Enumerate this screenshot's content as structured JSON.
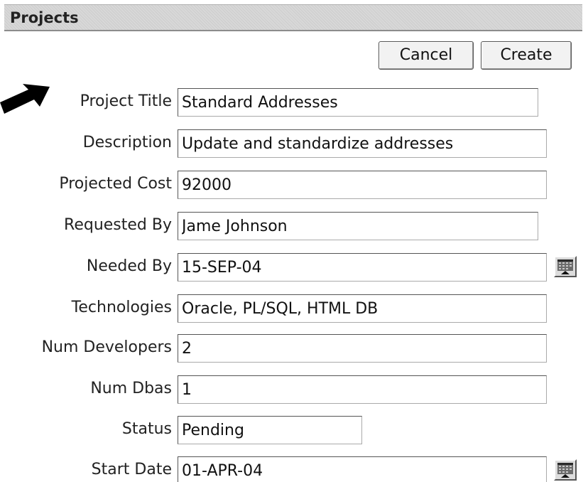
{
  "region": {
    "title": "Projects"
  },
  "buttons": {
    "cancel_label": "Cancel",
    "create_label": "Create"
  },
  "fields": [
    {
      "label": "Project Title",
      "value": "Standard Addresses"
    },
    {
      "label": "Description",
      "value": "Update and standardize addresses"
    },
    {
      "label": "Projected Cost",
      "value": "92000"
    },
    {
      "label": "Requested By",
      "value": "Jame Johnson"
    },
    {
      "label": "Needed By",
      "value": "15-SEP-04",
      "has_calendar": true
    },
    {
      "label": "Technologies",
      "value": "Oracle, PL/SQL, HTML DB"
    },
    {
      "label": "Num Developers",
      "value": "2"
    },
    {
      "label": "Num Dbas",
      "value": "1"
    },
    {
      "label": "Status",
      "value": "Pending"
    },
    {
      "label": "Start Date",
      "value": "01-APR-04",
      "has_calendar": true
    }
  ],
  "icons": {
    "pointer": "black-arrow-pointer-icon",
    "calendar": "calendar-icon"
  }
}
